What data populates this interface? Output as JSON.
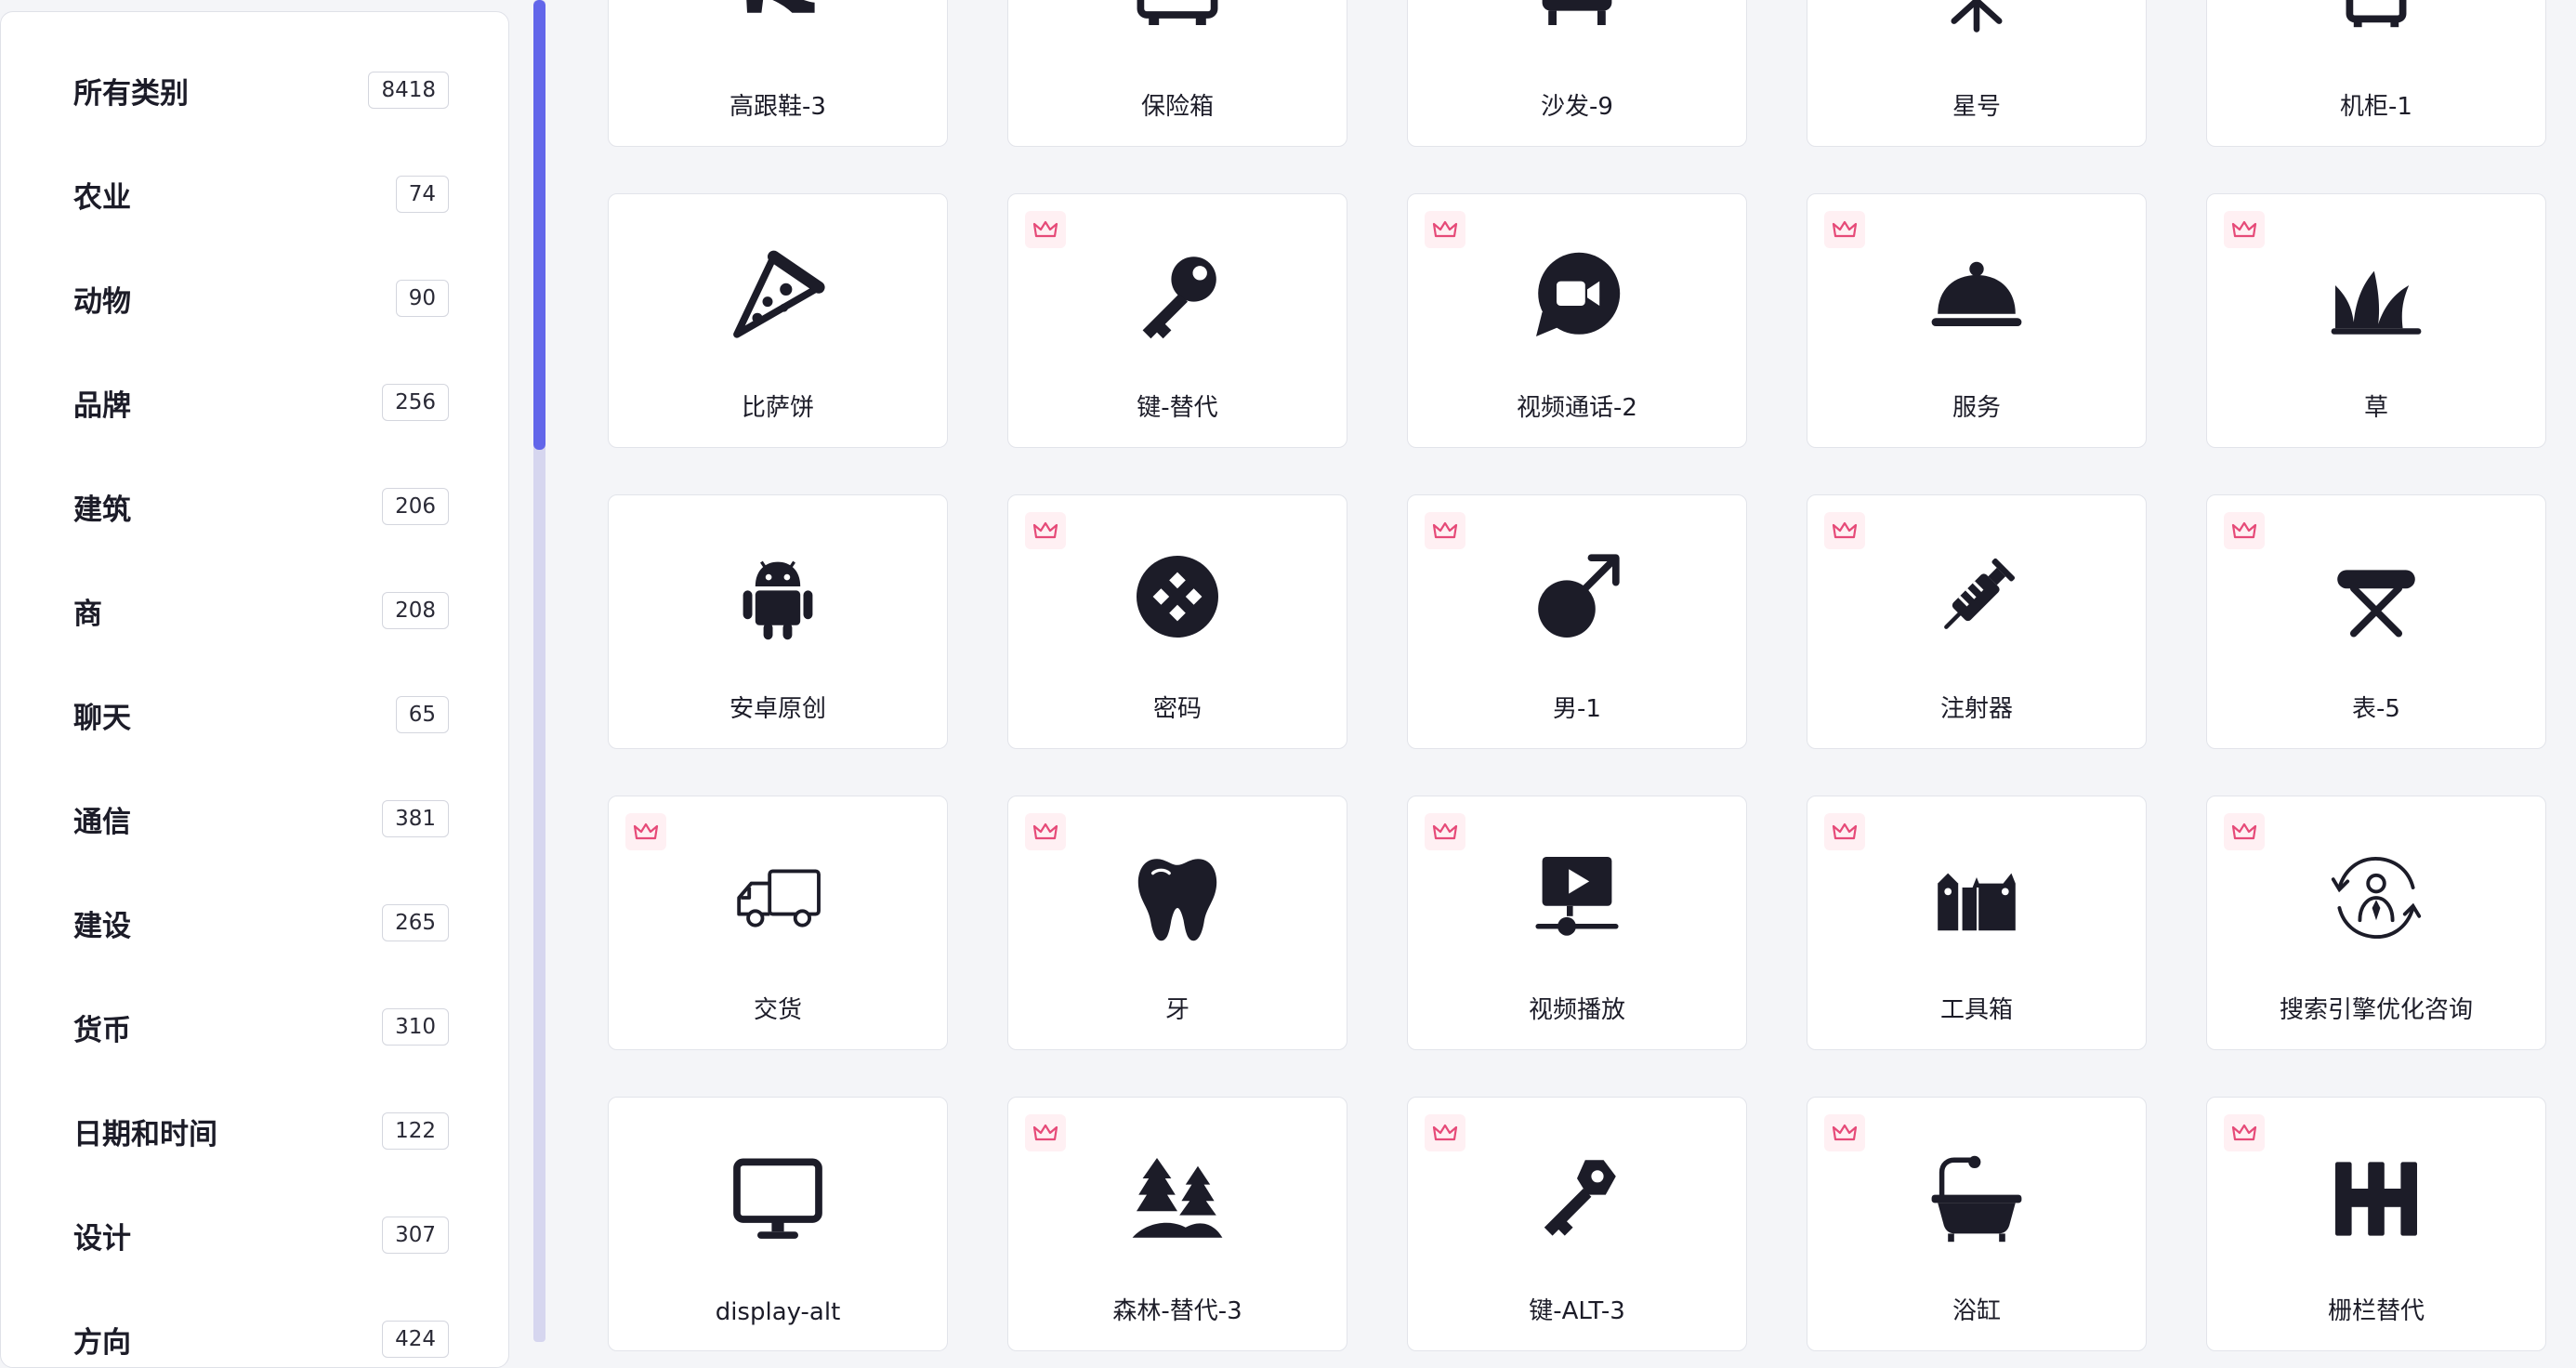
{
  "accent_color": "#6266ea",
  "premium_color": "#e64a78",
  "sidebar": {
    "categories": [
      {
        "label": "所有类别",
        "count": "8418"
      },
      {
        "label": "农业",
        "count": "74"
      },
      {
        "label": "动物",
        "count": "90"
      },
      {
        "label": "品牌",
        "count": "256"
      },
      {
        "label": "建筑",
        "count": "206"
      },
      {
        "label": "商",
        "count": "208"
      },
      {
        "label": "聊天",
        "count": "65"
      },
      {
        "label": "通信",
        "count": "381"
      },
      {
        "label": "建设",
        "count": "265"
      },
      {
        "label": "货币",
        "count": "310"
      },
      {
        "label": "日期和时间",
        "count": "122"
      },
      {
        "label": "设计",
        "count": "307"
      },
      {
        "label": "方向",
        "count": "424"
      }
    ]
  },
  "icons": {
    "row0": [
      {
        "label": "高跟鞋-3",
        "icon": "high-heel-icon"
      },
      {
        "label": "保险箱",
        "icon": "safe-box-icon"
      },
      {
        "label": "沙发-9",
        "icon": "sofa-icon"
      },
      {
        "label": "星号",
        "icon": "asterisk-icon"
      },
      {
        "label": "机柜-1",
        "icon": "cabinet-icon"
      }
    ],
    "row1": [
      {
        "label": "比萨饼",
        "icon": "pizza-icon",
        "premium": false
      },
      {
        "label": "键-替代",
        "icon": "key-icon",
        "premium": true
      },
      {
        "label": "视频通话-2",
        "icon": "video-call-icon",
        "premium": true
      },
      {
        "label": "服务",
        "icon": "cloche-icon",
        "premium": true
      },
      {
        "label": "草",
        "icon": "grass-icon",
        "premium": true
      }
    ],
    "row2": [
      {
        "label": "安卓原创",
        "icon": "android-icon",
        "premium": false
      },
      {
        "label": "密码",
        "icon": "password-icon",
        "premium": true
      },
      {
        "label": "男-1",
        "icon": "male-icon",
        "premium": true
      },
      {
        "label": "注射器",
        "icon": "syringe-icon",
        "premium": true
      },
      {
        "label": "表-5",
        "icon": "table-icon",
        "premium": true
      }
    ],
    "row3": [
      {
        "label": "交货",
        "icon": "delivery-truck-icon",
        "premium": true
      },
      {
        "label": "牙",
        "icon": "tooth-icon",
        "premium": true
      },
      {
        "label": "视频播放",
        "icon": "video-play-icon",
        "premium": true
      },
      {
        "label": "工具箱",
        "icon": "toolbox-icon",
        "premium": true
      },
      {
        "label": "搜索引擎优化咨询",
        "icon": "seo-consulting-icon",
        "premium": true
      }
    ],
    "row4": [
      {
        "label": "display-alt",
        "icon": "monitor-icon",
        "premium": false
      },
      {
        "label": "森林-替代-3",
        "icon": "forest-icon",
        "premium": true
      },
      {
        "label": "键-ALT-3",
        "icon": "key-alt-icon",
        "premium": true
      },
      {
        "label": "浴缸",
        "icon": "bathtub-icon",
        "premium": true
      },
      {
        "label": "栅栏替代",
        "icon": "fence-icon",
        "premium": true
      }
    ]
  }
}
